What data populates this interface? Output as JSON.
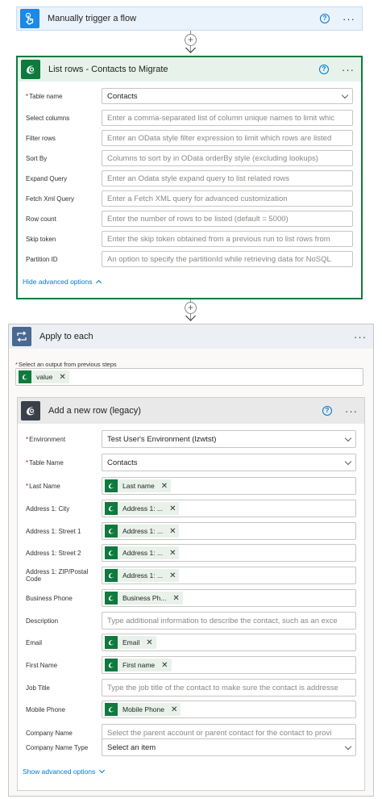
{
  "colors": {
    "trigger_accent": "#1e88e5",
    "list_accent": "#0e7a3e",
    "apply_accent": "#486991",
    "add_row_accent": "#3a3f49",
    "link": "#0078d4",
    "required": "#a4262c"
  },
  "trigger": {
    "title": "Manually trigger a flow",
    "icon": "hand-touch-icon"
  },
  "list_rows": {
    "title": "List rows - Contacts to Migrate",
    "icon": "dataverse-icon",
    "fields": [
      {
        "label": "Table name",
        "required": true,
        "value": "Contacts",
        "placeholder": ""
      },
      {
        "label": "Select columns",
        "required": false,
        "value": "",
        "placeholder": "Enter a comma-separated list of column unique names to limit whic"
      },
      {
        "label": "Filter rows",
        "required": false,
        "value": "",
        "placeholder": "Enter an OData style filter expression to limit which rows are listed"
      },
      {
        "label": "Sort By",
        "required": false,
        "value": "",
        "placeholder": "Columns to sort by in OData orderBy style (excluding lookups)"
      },
      {
        "label": "Expand Query",
        "required": false,
        "value": "",
        "placeholder": "Enter an Odata style expand query to list related rows"
      },
      {
        "label": "Fetch Xml Query",
        "required": false,
        "value": "",
        "placeholder": "Enter a Fetch XML query for advanced customization"
      },
      {
        "label": "Row count",
        "required": false,
        "value": "",
        "placeholder": "Enter the number of rows to be listed (default = 5000)"
      },
      {
        "label": "Skip token",
        "required": false,
        "value": "",
        "placeholder": "Enter the skip token obtained from a previous run to list rows from"
      },
      {
        "label": "Partition ID",
        "required": false,
        "value": "",
        "placeholder": "An option to specify the partitionId while retrieving data for NoSQL"
      }
    ],
    "advanced_link": "Hide advanced options"
  },
  "apply_each": {
    "title": "Apply to each",
    "icon": "loop-icon",
    "select_label": "Select an output from previous steps",
    "token": "value"
  },
  "add_row": {
    "title": "Add a new row (legacy)",
    "icon": "dataverse-icon",
    "environment": {
      "label": "Environment",
      "value": "Test User's Environment (lzwtst)"
    },
    "table_name": {
      "label": "Table Name",
      "value": "Contacts"
    },
    "fields": [
      {
        "label": "Last Name",
        "required": true,
        "token": "Last name"
      },
      {
        "label": "Address 1: City",
        "required": false,
        "token": "Address 1: ..."
      },
      {
        "label": "Address 1: Street 1",
        "required": false,
        "token": "Address 1: ..."
      },
      {
        "label": "Address 1: Street 2",
        "required": false,
        "token": "Address 1: ..."
      },
      {
        "label": "Address 1: ZIP/Postal Code",
        "required": false,
        "token": "Address 1: ..."
      },
      {
        "label": "Business Phone",
        "required": false,
        "token": "Business Ph..."
      },
      {
        "label": "Description",
        "required": false,
        "placeholder": "Type additional information to describe the contact, such as an exce"
      },
      {
        "label": "Email",
        "required": false,
        "token": "Email"
      },
      {
        "label": "First Name",
        "required": false,
        "token": "First name"
      },
      {
        "label": "Job Title",
        "required": false,
        "placeholder": "Type the job title of the contact to make sure the contact is addresse"
      },
      {
        "label": "Mobile Phone",
        "required": false,
        "token": "Mobile Phone"
      },
      {
        "label": "Company Name",
        "required": false,
        "placeholder": "Select the parent account or parent contact for the contact to provi"
      }
    ],
    "company_type": {
      "label": "Company Name Type",
      "value": "Select an item"
    },
    "advanced_link": "Show advanced options"
  },
  "common": {
    "help": "?",
    "more": "···",
    "plus": "+",
    "remove": "✕"
  }
}
